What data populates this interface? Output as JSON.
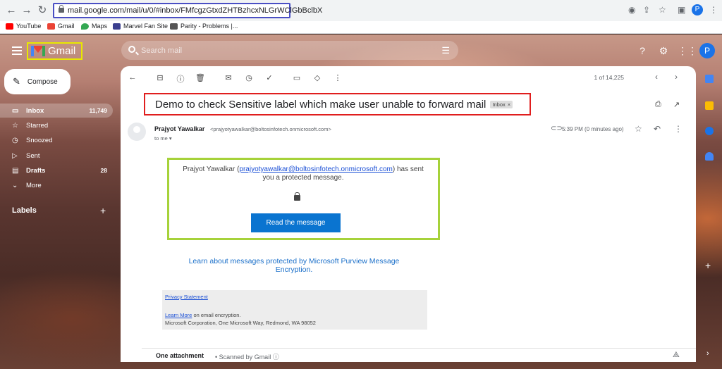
{
  "browser": {
    "url": "mail.google.com/mail/u/0/#inbox/FMfcgzGtxdZHTBzhcxNLGrWClGbBclbX",
    "profile_initial": "P",
    "bookmarks": [
      "YouTube",
      "Gmail",
      "Maps",
      "Marvel Fan Site",
      "Parity - Problems |..."
    ]
  },
  "header": {
    "app_name": "Gmail",
    "search_placeholder": "Search mail",
    "user_initial": "P"
  },
  "sidebar": {
    "compose_label": "Compose",
    "items": [
      {
        "label": "Inbox",
        "count": "11,749"
      },
      {
        "label": "Starred",
        "count": ""
      },
      {
        "label": "Snoozed",
        "count": ""
      },
      {
        "label": "Sent",
        "count": ""
      },
      {
        "label": "Drafts",
        "count": "28"
      },
      {
        "label": "More",
        "count": ""
      }
    ],
    "labels_title": "Labels"
  },
  "toolbar": {
    "pager": "1 of 14,225"
  },
  "email": {
    "subject": "Demo to check Sensitive label which make user unable to forward mail",
    "label_chip": "Inbox",
    "sender_name": "Prajyot Yawalkar",
    "sender_email": "<prajyotyawalkar@boltosinfotech.onmicrosoft.com>",
    "to": "to me",
    "timestamp": "5:39 PM (0 minutes ago)",
    "body": {
      "intro_name": "Prajyot Yawalkar (",
      "intro_email": "prajyotyawalkar@boltosinfotech.onmicrosoft.com",
      "intro_rest": ") has sent you a protected message.",
      "button": "Read the message",
      "learn_link": "Learn about messages protected by Microsoft Purview Message Encryption.",
      "privacy": "Privacy Statement",
      "learn_more": "Learn More",
      "learn_more_rest": " on email encryption.",
      "address": "Microsoft Corporation, One Microsoft Way, Redmond, WA 98052"
    },
    "attachment_title": "One attachment",
    "scanned": "• Scanned by Gmail ⓘ"
  },
  "colors": {
    "highlight_url": "#4a4fc4",
    "highlight_logo": "#e8e800",
    "highlight_subject": "#e01e1e",
    "highlight_body": "#a6d23a",
    "button_blue": "#0a74d0"
  }
}
